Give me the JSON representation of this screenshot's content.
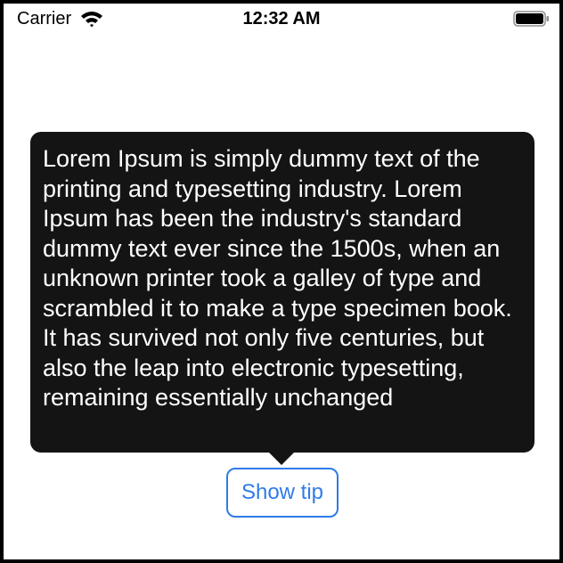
{
  "status_bar": {
    "carrier": "Carrier",
    "time": "12:32 AM",
    "wifi_icon": "wifi-icon",
    "battery_icon": "battery-icon"
  },
  "tooltip": {
    "text": "Lorem Ipsum is simply dummy text of the printing and typesetting industry. Lorem Ipsum has been the industry's standard dummy text ever since the 1500s, when an unknown printer took a galley of type and scrambled it to make a type specimen book. It has survived not only five centuries, but also the leap into electronic typesetting, remaining essentially unchanged"
  },
  "button": {
    "label": "Show tip"
  },
  "colors": {
    "accent": "#2f7be8",
    "tooltip_background": "#141414",
    "screen_background": "#ffffff"
  }
}
